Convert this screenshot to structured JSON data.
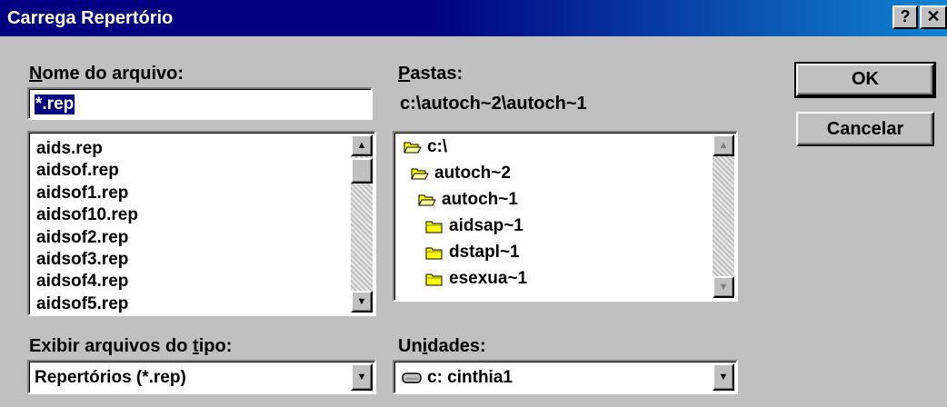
{
  "window": {
    "title": "Carrega Repertório",
    "help_glyph": "?",
    "close_glyph": "✕"
  },
  "file_name": {
    "label_accel": "N",
    "label_rest": "ome do arquivo:",
    "value": "*.rep"
  },
  "files": [
    "aids.rep",
    "aidsof.rep",
    "aidsof1.rep",
    "aidsof10.rep",
    "aidsof2.rep",
    "aidsof3.rep",
    "aidsof4.rep",
    "aidsof5.rep"
  ],
  "folders": {
    "label_accel": "P",
    "label_rest": "astas:",
    "current_path": "c:\\autoch~2\\autoch~1",
    "items": [
      {
        "name": "c:\\",
        "icon": "open-folder-icon"
      },
      {
        "name": "autoch~2",
        "icon": "open-folder-icon"
      },
      {
        "name": "autoch~1",
        "icon": "open-folder-icon"
      },
      {
        "name": "aidsap~1",
        "icon": "folder-icon"
      },
      {
        "name": "dstapl~1",
        "icon": "folder-icon"
      },
      {
        "name": "esexua~1",
        "icon": "folder-icon"
      }
    ]
  },
  "file_type": {
    "label_pre": "Exibir arquivos do ",
    "label_accel": "t",
    "label_post": "ipo:",
    "selected": "Repertórios (*.rep)"
  },
  "drives": {
    "label_pre": "Un",
    "label_accel": "i",
    "label_post": "dades:",
    "selected": "c: cinthia1",
    "icon": "drive-icon"
  },
  "buttons": {
    "ok": "OK",
    "cancel": "Cancelar"
  },
  "glyphs": {
    "up": "▲",
    "down": "▼"
  }
}
